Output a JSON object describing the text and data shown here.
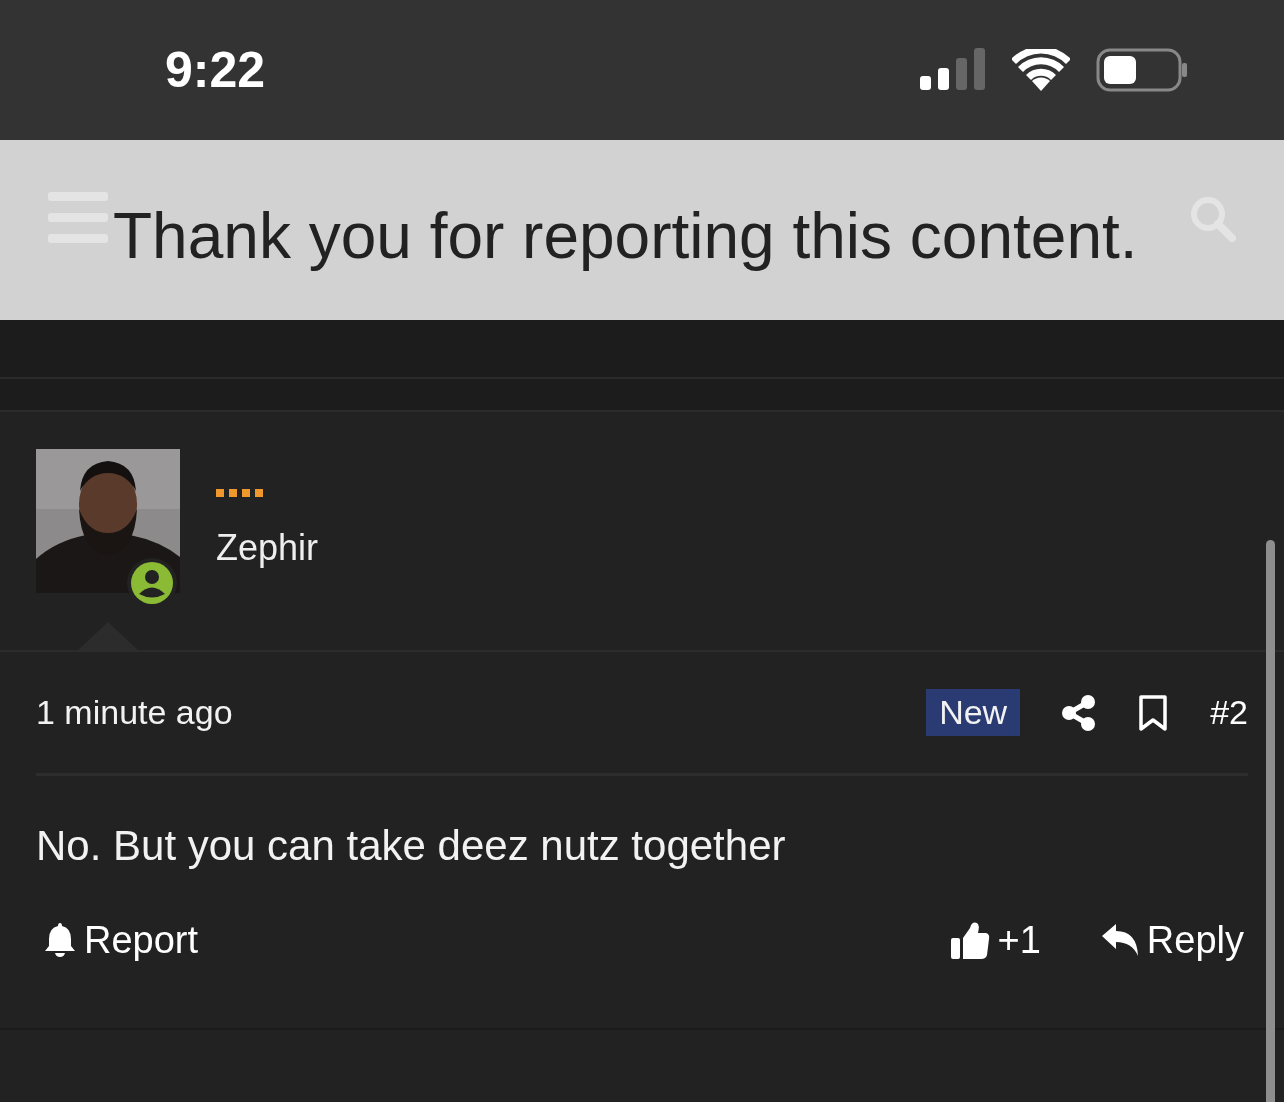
{
  "status_bar": {
    "time": "9:22"
  },
  "notice": {
    "text": "Thank you for reporting this content."
  },
  "post": {
    "author": {
      "name": "Zephir",
      "online": true
    },
    "time": "1 minute ago",
    "badge": "New",
    "number": "#2",
    "body": "No. But you can take deez nutz together",
    "actions": {
      "report": "Report",
      "reaction_count": "+1",
      "reply": "Reply"
    }
  }
}
